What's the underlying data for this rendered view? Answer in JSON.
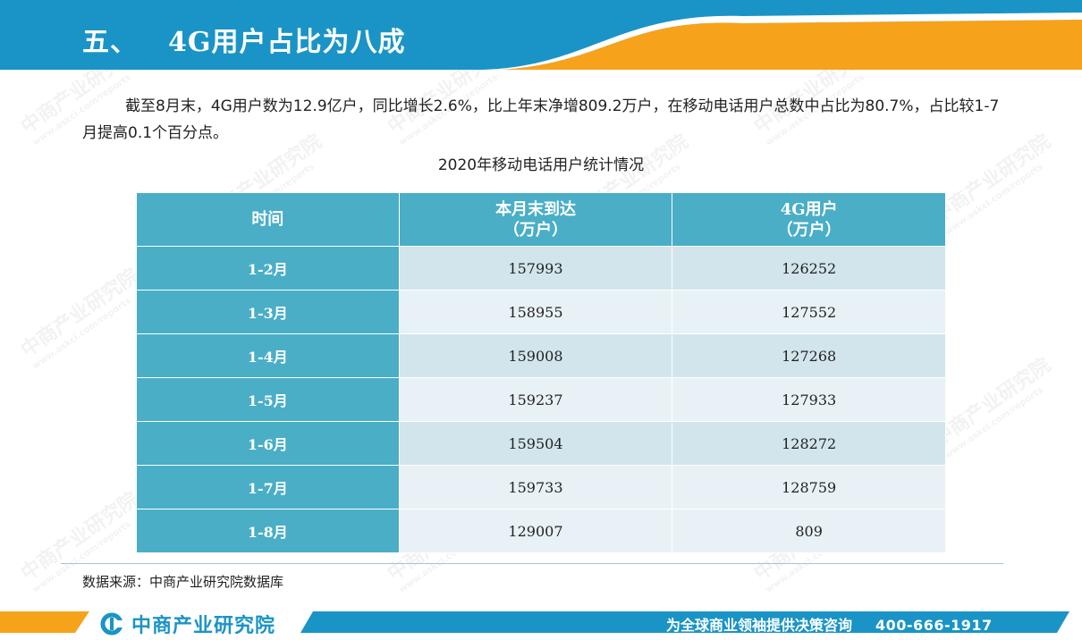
{
  "header": {
    "section_number": "五、",
    "title": "4G用户占比为八成"
  },
  "summary": {
    "text": "截至8月末，4G用户数为12.9亿户，同比增长2.6%，比上年末净增809.2万户，在移动电话用户总数中占比为80.7%，占比较1-7月提高0.1个百分点。"
  },
  "table": {
    "title": "2020年移动电话用户统计情况",
    "headers": {
      "period": "时间",
      "total_line1": "本月末到达",
      "total_line2": "（万户）",
      "lte_line1": "4G用户",
      "lte_line2": "（万户）"
    },
    "rows": [
      {
        "period": "1-2月",
        "total": "157993",
        "lte": "126252"
      },
      {
        "period": "1-3月",
        "total": "158955",
        "lte": "127552"
      },
      {
        "period": "1-4月",
        "total": "159008",
        "lte": "127268"
      },
      {
        "period": "1-5月",
        "total": "159237",
        "lte": "127933"
      },
      {
        "period": "1-6月",
        "total": "159504",
        "lte": "128272"
      },
      {
        "period": "1-7月",
        "total": "159733",
        "lte": "128759"
      },
      {
        "period": "1-8月",
        "total": "129007",
        "lte": "809"
      }
    ]
  },
  "source": {
    "text": "数据来源：中商产业研究院数据库"
  },
  "footer": {
    "logo_text": "中商产业研究院",
    "slogan": "为全球商业领袖提供决策咨询",
    "phone": "400-666-1917"
  },
  "watermark": {
    "brand": "中商产业研究院",
    "url": "www.askci.com/reports"
  },
  "colors": {
    "header_blue": "#1a94c6",
    "accent_orange": "#f7a21b",
    "table_header": "#4aaec7",
    "row_a": "#d2e5ec",
    "row_b": "#e8f1f5"
  },
  "icons": {
    "logo": "askci-logo-icon",
    "arrow": "footer-arrow-icon"
  }
}
